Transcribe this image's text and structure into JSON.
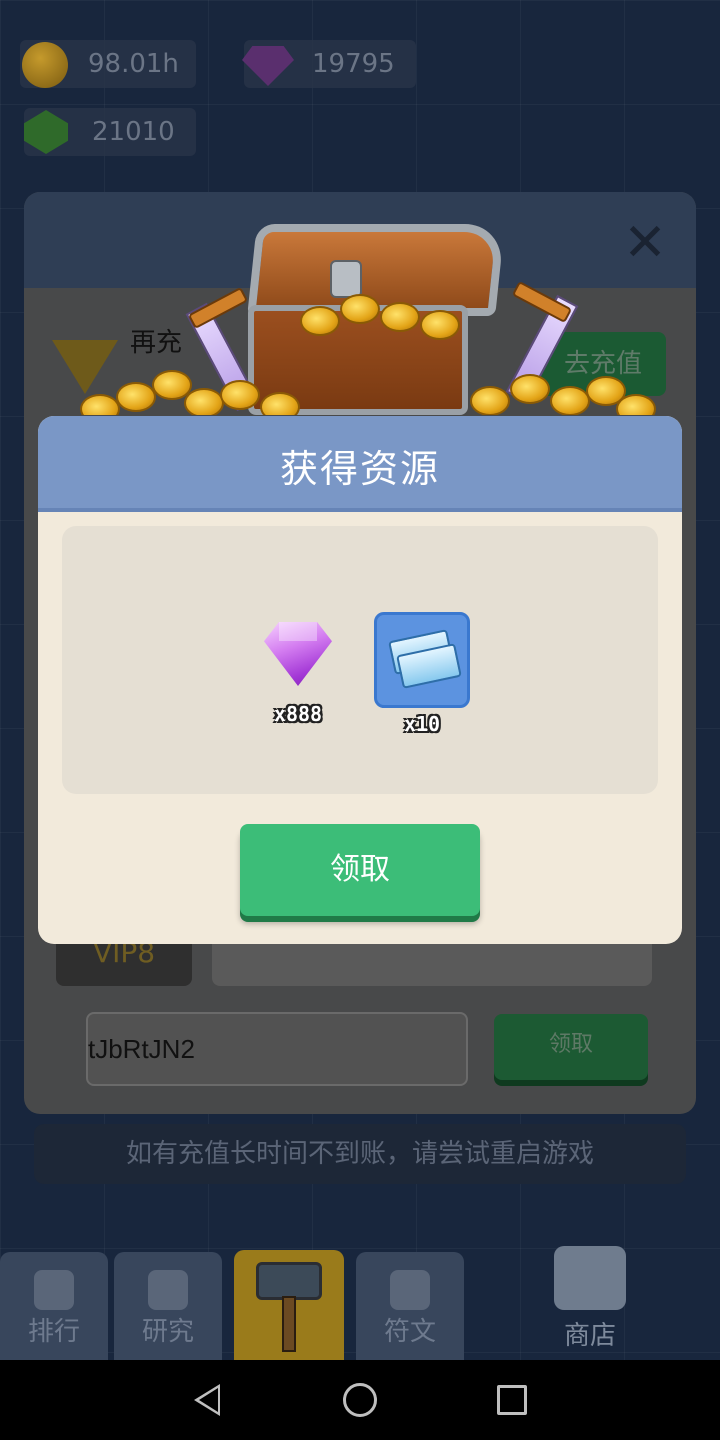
{
  "top_resources": {
    "coin_value": "98.01h",
    "gem_value": "19795",
    "green_value": "21010"
  },
  "recharge_panel": {
    "recharge_more_text": "再充",
    "goto_recharge_label": "去充值",
    "vip_level_label": "VIP8",
    "redeem_code_value": "tJbRtJN2",
    "redeem_claim_label": "领取"
  },
  "notice": "如有充值长时间不到账，请尝试重启游戏",
  "modal": {
    "title": "获得资源",
    "rewards": [
      {
        "icon": "purple-gem-icon",
        "count": "x888"
      },
      {
        "icon": "blue-ticket-icon",
        "count": "x10"
      }
    ],
    "claim_label": "领取"
  },
  "bottom_nav": [
    {
      "label": "排行",
      "icon": "trophy-icon"
    },
    {
      "label": "研究",
      "icon": "flask-icon"
    },
    {
      "label": "",
      "icon": "hammer-icon"
    },
    {
      "label": "符文",
      "icon": "rune-icon"
    },
    {
      "label": "商店",
      "icon": "shop-icon"
    }
  ],
  "colors": {
    "modal_header": "#7a97c6",
    "modal_body": "#f2eadb",
    "claim_button": "#3cbd78"
  }
}
